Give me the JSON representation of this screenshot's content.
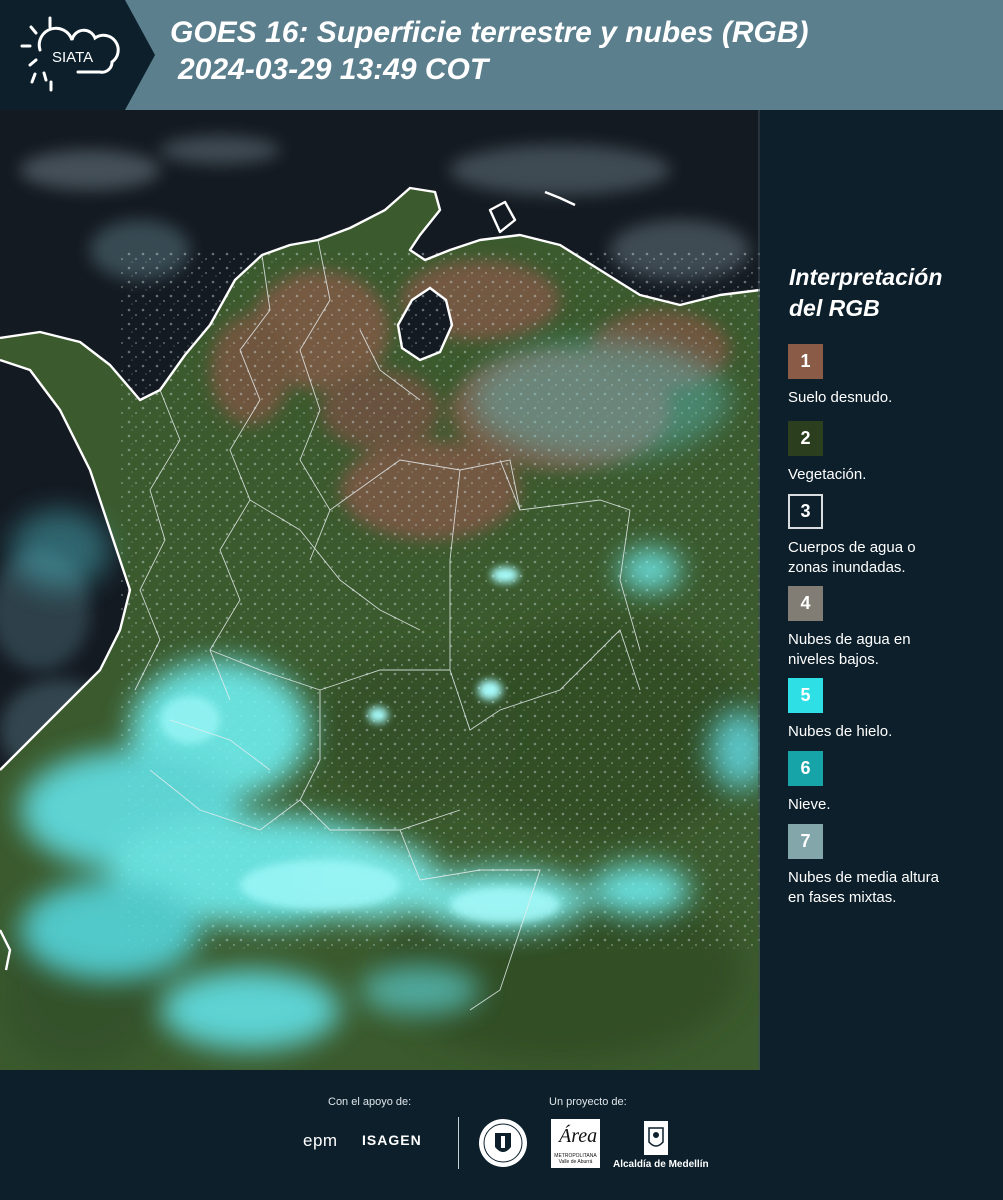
{
  "header": {
    "logo_text": "SIATA",
    "title_line1": "GOES 16: Superficie terrestre y nubes (RGB)",
    "title_line2": "2024-03-29 13:49 COT"
  },
  "legend": {
    "title_line1": "Interpretación",
    "title_line2": "del RGB",
    "items": [
      {
        "num": "1",
        "color": "#8a5c48",
        "label_line1": "Suelo desnudo.",
        "label_line2": ""
      },
      {
        "num": "2",
        "color": "#2b3f1f",
        "label_line1": "Vegetación.",
        "label_line2": ""
      },
      {
        "num": "3",
        "color": "#0c1f2b",
        "label_line1": "Cuerpos de agua o",
        "label_line2": "zonas inundadas."
      },
      {
        "num": "4",
        "color": "#817d74",
        "label_line1": "Nubes de agua en",
        "label_line2": "niveles bajos."
      },
      {
        "num": "5",
        "color": "#2ee0e6",
        "label_line1": "Nubes de hielo.",
        "label_line2": ""
      },
      {
        "num": "6",
        "color": "#17a4a8",
        "label_line1": "Nieve.",
        "label_line2": ""
      },
      {
        "num": "7",
        "color": "#82a6aa",
        "label_line1": "Nubes de media altura",
        "label_line2": "en fases mixtas."
      }
    ]
  },
  "footer": {
    "support_label": "Con el apoyo de:",
    "project_label": "Un proyecto de:",
    "epm": "epm",
    "isagen": "ISAGEN",
    "area_title": "Área",
    "area_sub1": "METROPOLITANA",
    "area_sub2": "Valle de Aburrá",
    "alcaldia": "Alcaldía de Medellín"
  },
  "colors": {
    "header_bg": "#5b7f8d",
    "panel_bg": "#0c1f2b",
    "vegetation": "#3a5a2c",
    "bare_soil": "#7d5a44",
    "ice_cloud": "#6ff0f2",
    "ocean": "#141a22"
  }
}
